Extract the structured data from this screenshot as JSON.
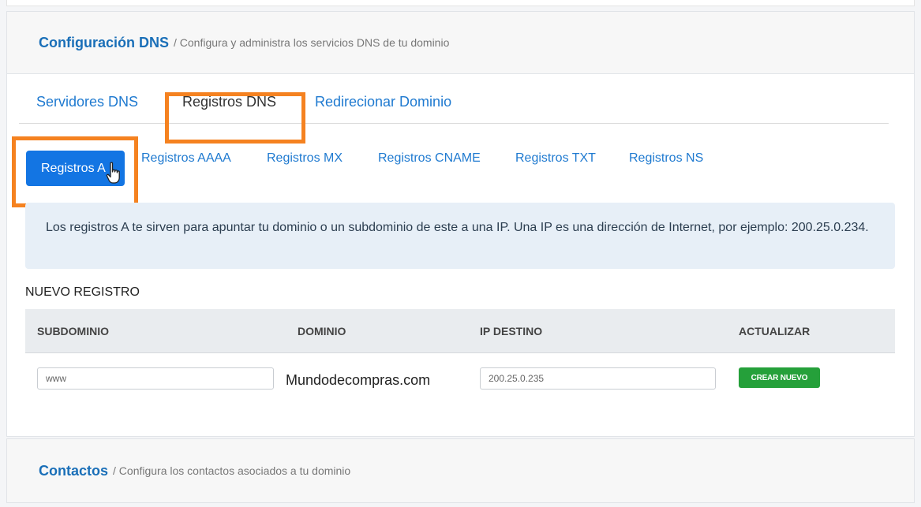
{
  "dns": {
    "title": "Configuración DNS",
    "subtitle": "/ Configura y administra los servicios DNS de tu dominio"
  },
  "tabs": [
    {
      "label": "Servidores DNS"
    },
    {
      "label": "Registros DNS"
    },
    {
      "label": "Redirecionar Dominio"
    }
  ],
  "subtabs": [
    {
      "label": "Registros A"
    },
    {
      "label": "Registros AAAA"
    },
    {
      "label": "Registros MX"
    },
    {
      "label": "Registros CNAME"
    },
    {
      "label": "Registros TXT"
    },
    {
      "label": "Registros NS"
    }
  ],
  "info": {
    "text": "Los registros A te sirven para apuntar tu dominio o un subdominio de este a una IP. Una IP es una dirección de Internet, por ejemplo: 200.25.0.234."
  },
  "new_record": {
    "title": "NUEVO REGISTRO",
    "columns": [
      "SUBDOMINIO",
      "DOMINIO",
      "IP DESTINO",
      "ACTUALIZAR"
    ],
    "subdomain_value": "www",
    "domain": "Mundodecompras.com",
    "ip_value": "200.25.0.235",
    "create_label": "CREAR NUEVO"
  },
  "contacts": {
    "title": "Contactos",
    "subtitle": "/ Configura los contactos asociados a tu dominio"
  },
  "colors": {
    "accent": "#1f7ad0",
    "active_button": "#1375e3",
    "create_button": "#25a03a",
    "highlight": "#f58220"
  },
  "icons": {
    "cursor": "hand-pointer-icon"
  }
}
